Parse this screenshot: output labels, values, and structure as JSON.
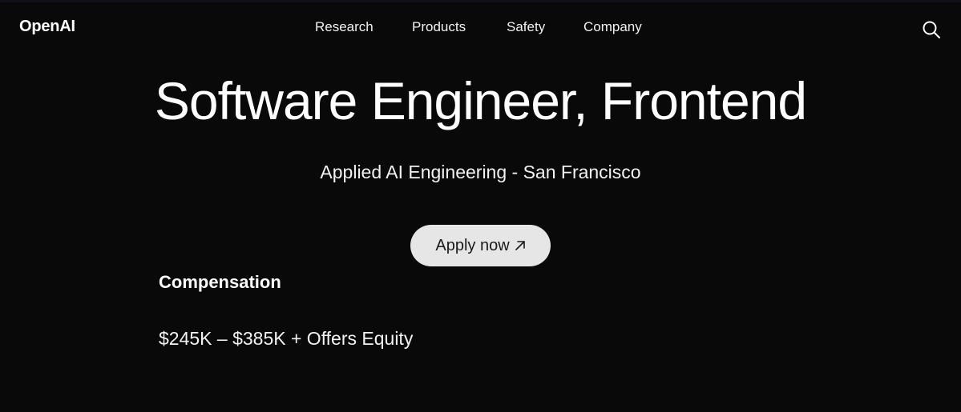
{
  "header": {
    "logo": "OpenAI",
    "nav": [
      {
        "label": "Research"
      },
      {
        "label": "Products"
      },
      {
        "label": "Safety"
      },
      {
        "label": "Company"
      }
    ],
    "search_icon": "search-icon"
  },
  "job": {
    "title": "Software Engineer, Frontend",
    "subtitle": "Applied AI Engineering - San Francisco",
    "apply_label": "Apply now",
    "apply_icon": "arrow-up-right-icon"
  },
  "compensation": {
    "heading": "Compensation",
    "value": "$245K – $385K + Offers Equity"
  },
  "colors": {
    "background": "#0a0909",
    "text": "#ffffff",
    "button_bg": "#e7e6e6",
    "button_text": "#1a1a1a"
  }
}
